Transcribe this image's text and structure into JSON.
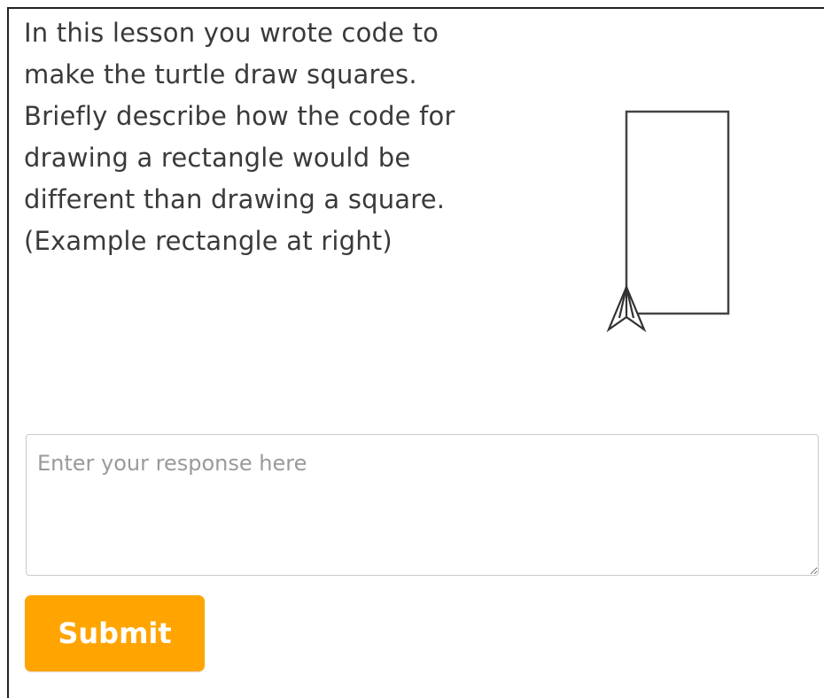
{
  "prompt": {
    "lines": [
      "In this lesson you wrote code to",
      "make the turtle draw squares.",
      "Briefly describe how the code for",
      "drawing a rectangle would be",
      "different than drawing a square.",
      "(Example rectangle at right)"
    ]
  },
  "figure": {
    "shape": "rectangle",
    "turtle_icon": "turtle-arrow-icon"
  },
  "response": {
    "placeholder": "Enter your response here",
    "value": ""
  },
  "submit": {
    "label": "Submit",
    "color": "#ffa400"
  },
  "colors": {
    "text": "#3a3a3a",
    "border": "#c9c9c9",
    "accent": "#ffa400"
  }
}
